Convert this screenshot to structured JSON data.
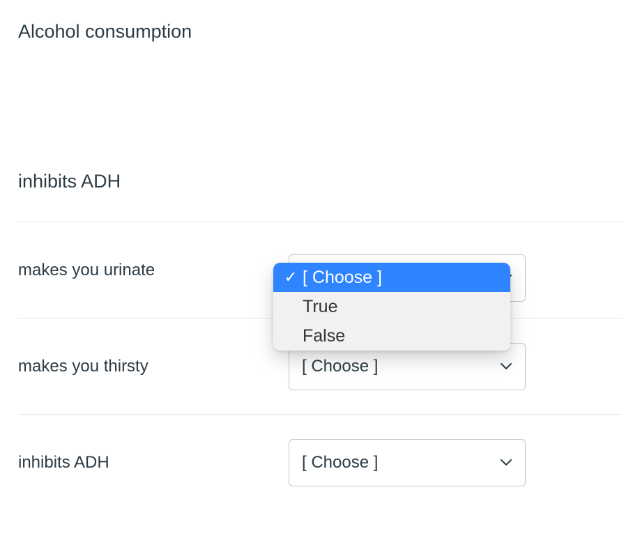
{
  "title": "Alcohol consumption",
  "subtitle": "inhibits ADH",
  "rows": {
    "0": {
      "label": "makes you urinate",
      "selected": "[ Choose ]"
    },
    "1": {
      "label": "makes you thirsty",
      "selected": "[ Choose ]"
    },
    "2": {
      "label": "inhibits ADH",
      "selected": "[ Choose ]"
    }
  },
  "dropdown": {
    "options": {
      "0": {
        "label": "[ Choose ]",
        "selected": true
      },
      "1": {
        "label": "True",
        "selected": false
      },
      "2": {
        "label": "False",
        "selected": false
      }
    }
  }
}
